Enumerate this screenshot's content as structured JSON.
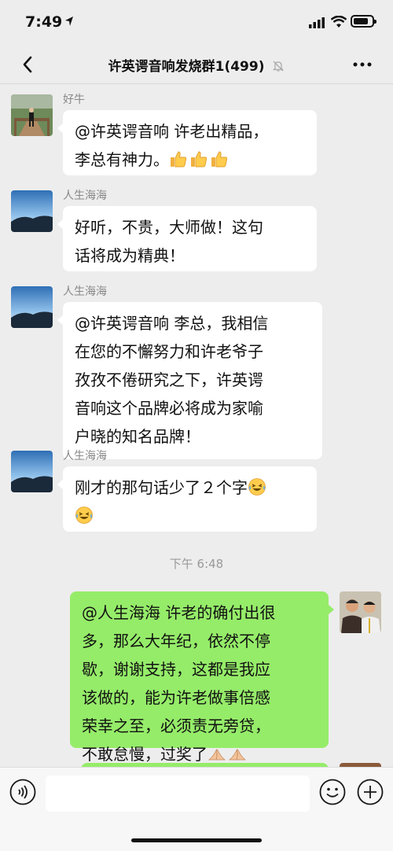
{
  "status": {
    "time": "7:49"
  },
  "header": {
    "title": "许英谔音响发烧群1(499)"
  },
  "messages": [
    {
      "sender": "好牛",
      "lines": [
        "@许英谔音响 许老出精品，",
        "李总有神力。"
      ],
      "emoji": [
        "thumbs-up",
        "thumbs-up",
        "thumbs-up"
      ]
    },
    {
      "sender": "人生海海",
      "lines": [
        "好听，不贵，大师做！这句",
        "话将成为精典！"
      ]
    },
    {
      "sender": "人生海海",
      "lines": [
        "@许英谔音响 李总，我相信",
        "在您的不懈努力和许老爷子",
        "孜孜不倦研究之下，许英谔",
        "音响这个品牌必将成为家喻",
        "户晓的知名品牌！"
      ]
    },
    {
      "sender": "人生海海",
      "lines": [
        "刚才的那句话少了２个字"
      ],
      "emoji": [
        "laughing-crying",
        "laughing-crying"
      ]
    },
    {
      "lines": [
        "@人生海海 许老的确付出很",
        "多，那么大年纪，依然不停",
        "歇，谢谢支持，这都是我应",
        "该做的，能为许老做事倍感",
        "荣幸之至，必须责无旁贷，",
        "不敢怠慢，过奖了"
      ],
      "emoji": [
        "clasped-hands",
        "clasped-hands"
      ]
    }
  ],
  "timestamp": "下午 6:48",
  "input": {
    "placeholder": ""
  },
  "icons": {
    "back": "chevron-left-icon",
    "mute": "bell-off-icon",
    "more": "more-dots-icon",
    "voice": "voice-icon",
    "emoji": "smile-icon",
    "plus": "plus-icon"
  },
  "colors": {
    "background": "#ededed",
    "self_bubble": "#95ec69",
    "other_bubble": "#ffffff"
  }
}
